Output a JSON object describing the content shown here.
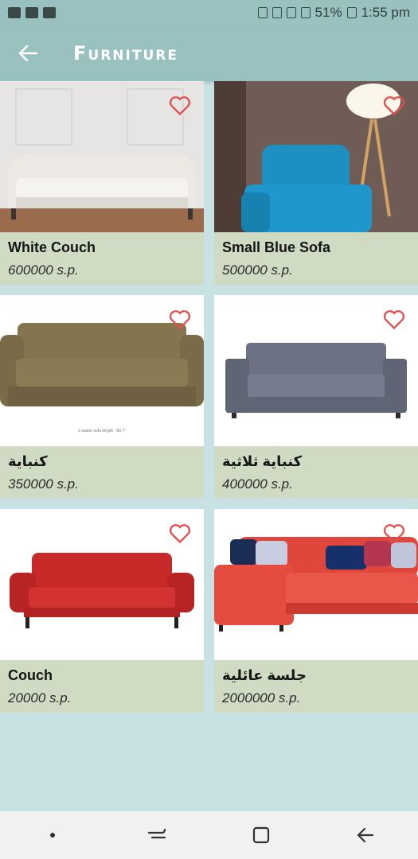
{
  "status_bar": {
    "battery": "51%",
    "time": "1:55 pm"
  },
  "app_bar": {
    "title": "Furniture"
  },
  "colors": {
    "accent": "#99c1c0",
    "background": "#c8e2e4",
    "card_info": "#cfdcc3",
    "heart": "#e25050"
  },
  "products": [
    {
      "name": "White Couch",
      "price": "600000 s.p.",
      "image": "white-tufted-couch"
    },
    {
      "name": "Small Blue Sofa",
      "price": "500000 s.p.",
      "image": "blue-armchair"
    },
    {
      "name": "كنباية",
      "price": "350000 s.p.",
      "image": "brown-sofa"
    },
    {
      "name": "كنباية ثلاثية",
      "price": "400000 s.p.",
      "image": "grey-three-seat-sofa"
    },
    {
      "name": "Couch",
      "price": "20000 s.p.",
      "image": "red-sofa"
    },
    {
      "name": "جلسة عائلية",
      "price": "2000000 s.p.",
      "image": "red-sectional"
    }
  ],
  "nav": {
    "items": [
      "recents-button",
      "home-button",
      "back-button"
    ]
  }
}
